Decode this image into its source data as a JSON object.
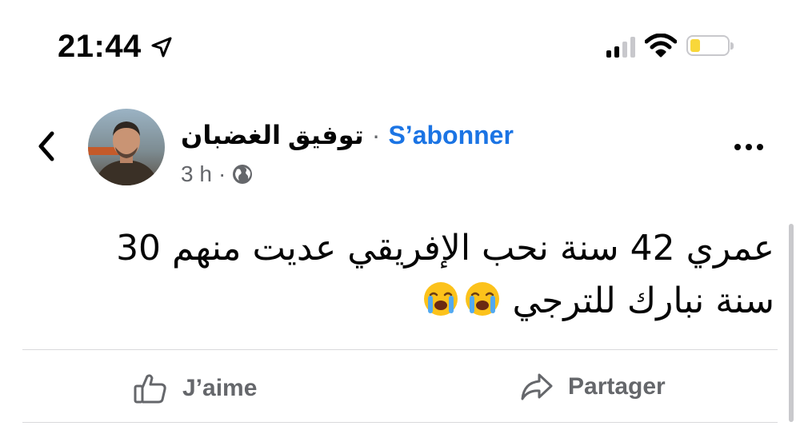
{
  "status_bar": {
    "time": "21:44",
    "icons": [
      "location-arrow-icon",
      "cellular-signal-icon",
      "wifi-icon",
      "battery-icon"
    ],
    "battery_color": "#f8d73a"
  },
  "post": {
    "author": "توفيق الغضبان",
    "separator": "·",
    "follow_label": "S’abonner",
    "time": "3 h",
    "meta_separator": "·",
    "privacy_icon": "globe-icon",
    "text_line1": "عمري 42 سنة نحب الإفريقي عديت منهم 30",
    "text_line2": "سنة نبارك للترجي",
    "emojis": [
      "loudly-crying-face",
      "loudly-crying-face"
    ]
  },
  "actions": {
    "like_label": "J’aime",
    "share_label": "Partager"
  },
  "colors": {
    "accent": "#1b74e4",
    "secondary_text": "#65676b",
    "divider": "#d9d9dc"
  }
}
